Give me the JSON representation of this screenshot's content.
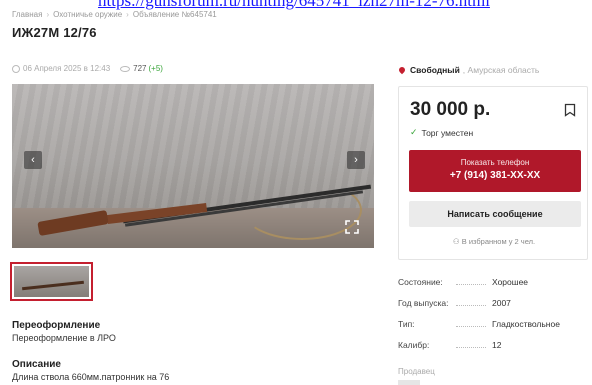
{
  "top_link": "https://gunsforum.ru/hunting/645741_izh27m-12-76.html",
  "breadcrumb": {
    "home": "Главная",
    "category": "Охотничье оружие",
    "current": "Объявление №645741"
  },
  "title": "ИЖ27М 12/76",
  "meta": {
    "date": "06 Апреля 2025 в 12:43",
    "views": "727",
    "views_delta": "(+5)"
  },
  "location": {
    "city": "Свободный",
    "region": ", Амурская область"
  },
  "price_card": {
    "price": "30 000 р.",
    "bargain": "Торг уместен",
    "phone_button_label": "Показать телефон",
    "phone_masked": "+7 (914) 381-XX-XX",
    "message_button_label": "Написать сообщение",
    "favorites": "В избранном у 2 чел."
  },
  "gallery": {
    "prev": "‹",
    "next": "›"
  },
  "sections": [
    {
      "heading": "Переоформление",
      "text": "Переоформление в ЛРО"
    },
    {
      "heading": "Описание",
      "text": "Длина ствола 660мм.патронник на 76"
    }
  ],
  "specs": [
    {
      "key": "Состояние:",
      "value": "Хорошее"
    },
    {
      "key": "Год выпуска:",
      "value": "2007"
    },
    {
      "key": "Тип:",
      "value": "Гладкоствольное"
    },
    {
      "key": "Калибр:",
      "value": "12"
    }
  ],
  "seller_heading": "Продавец",
  "colors": {
    "accent": "#b0182a",
    "ok": "#3aa53a"
  }
}
